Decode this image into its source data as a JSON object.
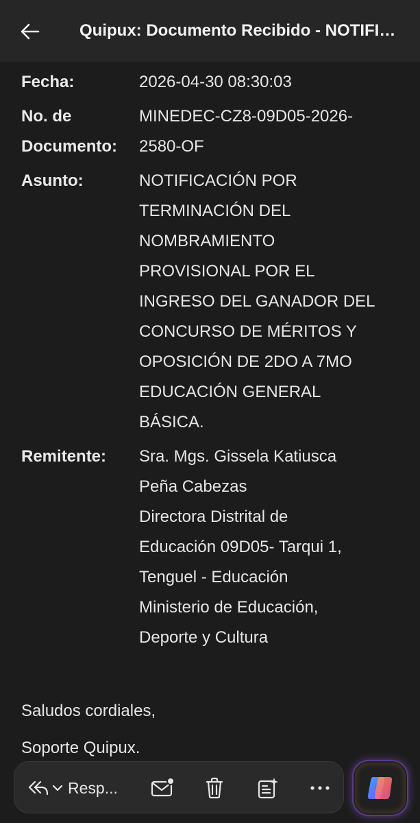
{
  "header": {
    "title": "Quipux: Documento Recibido  - NOTIFICACIÓN POR TERMINACIÓN"
  },
  "details": {
    "fecha_label": "Fecha:",
    "fecha_value": "2026-04-30 08:30:03",
    "documento_label_1": "No. de",
    "documento_label_2": "Documento:",
    "documento_value_1": "MINEDEC-CZ8-09D05-2026-",
    "documento_value_2": "2580-OF",
    "asunto_label": "Asunto:",
    "asunto_lines": [
      "NOTIFICACIÓN POR",
      "TERMINACIÓN DEL",
      "NOMBRAMIENTO",
      "PROVISIONAL POR EL",
      "INGRESO DEL GANADOR DEL",
      "CONCURSO DE MÉRITOS Y",
      "OPOSICIÓN DE 2DO A 7MO",
      "EDUCACIÓN GENERAL",
      "BÁSICA."
    ],
    "remitente_label": "Remitente:",
    "remitente_lines": [
      "Sra. Mgs. Gissela Katiusca",
      "Peña Cabezas",
      "Directora Distrital de",
      "Educación 09D05- Tarqui 1,",
      "Tenguel - Educación",
      "Ministerio de Educación,",
      "Deporte y Cultura"
    ]
  },
  "closing": {
    "line1": "Saludos cordiales,",
    "line2": "Soporte Quipux."
  },
  "actionbar": {
    "reply_label": "Resp...",
    "icons": {
      "reply": "reply-all-icon",
      "dropdown": "chevron-down-icon",
      "mail": "mark-unread-icon",
      "trash": "trash-icon",
      "summary": "summary-sparkle-icon",
      "more": "more-horizontal-icon",
      "copilot": "copilot-icon"
    }
  },
  "colors": {
    "background": "#1c1c1c",
    "topbar": "#262626",
    "text": "#e6e6e6"
  }
}
